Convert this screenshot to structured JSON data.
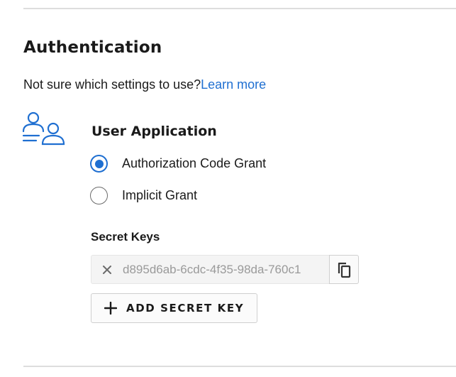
{
  "section": {
    "title": "Authentication",
    "helper_text": "Not sure which settings to use?",
    "helper_link": "Learn more"
  },
  "application": {
    "icon": "users-icon",
    "title": "User Application",
    "grant_options": [
      {
        "label": "Authorization Code Grant",
        "selected": true
      },
      {
        "label": "Implicit Grant",
        "selected": false
      }
    ]
  },
  "secret_keys": {
    "label": "Secret Keys",
    "keys": [
      {
        "value": "d895d6ab-6cdc-4f35-98da-760c1"
      }
    ],
    "remove_icon": "close-icon",
    "copy_icon": "copy-icon",
    "add_button_label": "ADD SECRET KEY",
    "add_icon": "plus-icon"
  },
  "colors": {
    "accent": "#1f6fd1",
    "text": "#1a1a1a",
    "muted_text": "#9a9a9a",
    "divider": "#dddddd",
    "field_background": "#f4f4f4"
  }
}
